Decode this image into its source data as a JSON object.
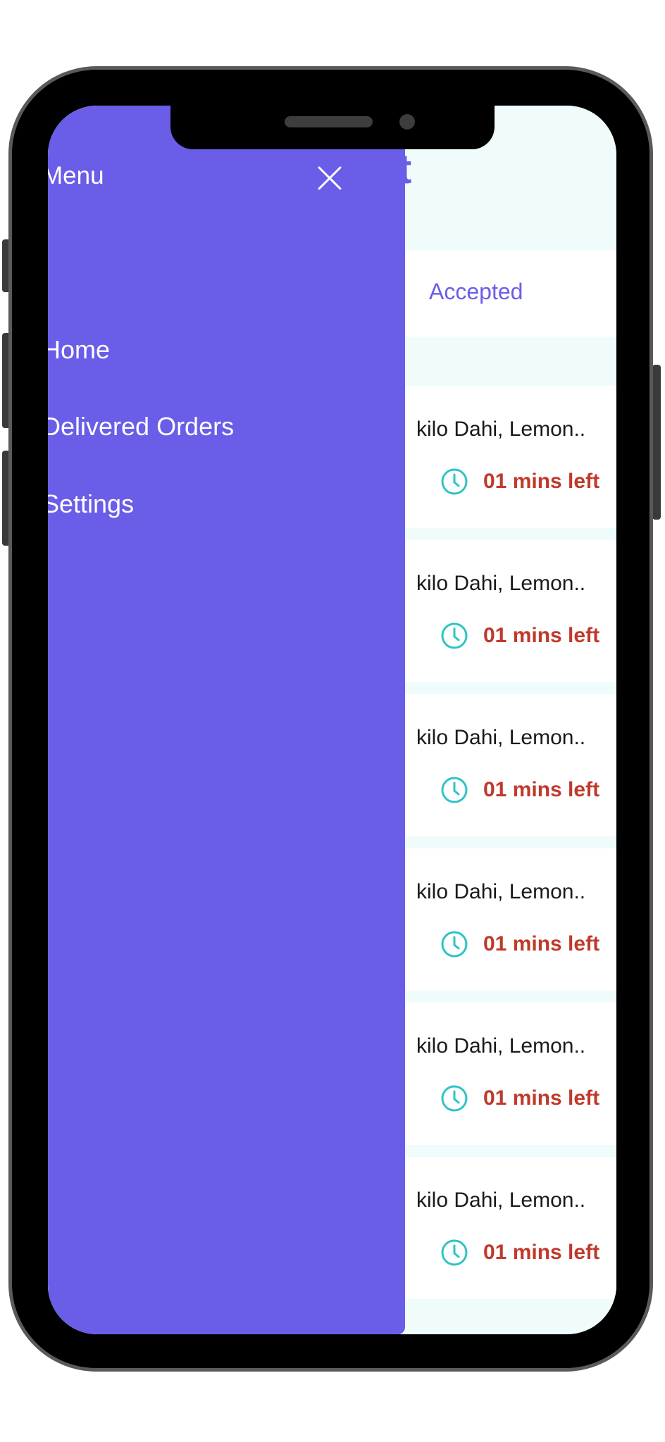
{
  "app": {
    "title_fragment": "t",
    "tab_label": "Accepted"
  },
  "orders": [
    {
      "items": "kilo Dahi, Lemon..",
      "time_left": "01 mins left"
    },
    {
      "items": "kilo Dahi, Lemon..",
      "time_left": "01 mins left"
    },
    {
      "items": "kilo Dahi, Lemon..",
      "time_left": "01 mins left"
    },
    {
      "items": "kilo Dahi, Lemon..",
      "time_left": "01 mins left"
    },
    {
      "items": "kilo Dahi, Lemon..",
      "time_left": "01 mins left"
    },
    {
      "items": "kilo Dahi, Lemon..",
      "time_left": "01 mins left"
    }
  ],
  "drawer": {
    "title": "Menu",
    "close_icon": "close-icon",
    "items": [
      {
        "label": "Home"
      },
      {
        "label": "Delivered Orders"
      },
      {
        "label": "Settings"
      }
    ]
  },
  "colors": {
    "accent": "#6a5de8",
    "time_warning": "#c0392b",
    "clock": "#2ec4c4",
    "background": "#f0fcfc"
  }
}
